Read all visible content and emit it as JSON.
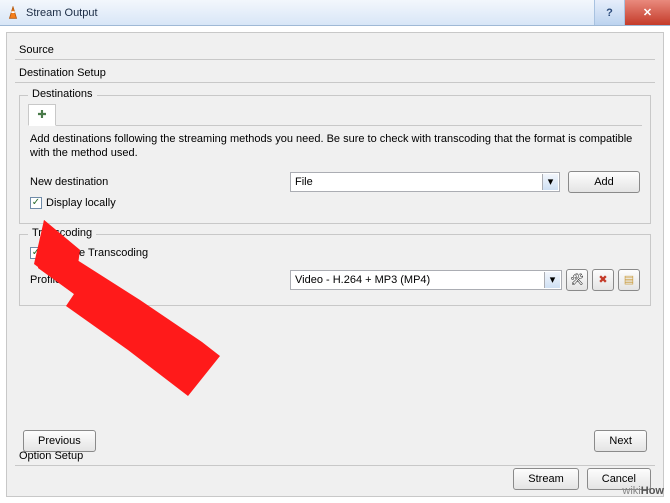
{
  "window": {
    "title": "Stream Output"
  },
  "sections": {
    "source": "Source",
    "destination_setup": "Destination Setup",
    "option_setup": "Option Setup"
  },
  "destinations": {
    "legend": "Destinations",
    "add_tab": "✚",
    "description": "Add destinations following the streaming methods you need. Be sure to check with transcoding that the format is compatible with the method used.",
    "new_destination_label": "New destination",
    "new_destination_value": "File",
    "add_button": "Add",
    "display_locally": {
      "label": "Display locally",
      "checked": true
    }
  },
  "transcoding": {
    "legend": "Transcoding",
    "activate": {
      "label": "Activate Transcoding",
      "checked": true
    },
    "profile_label": "Profile",
    "profile_value": "Video - H.264 + MP3 (MP4)"
  },
  "buttons": {
    "previous": "Previous",
    "next": "Next",
    "stream": "Stream",
    "cancel": "Cancel"
  },
  "watermark": {
    "prefix": "wiki",
    "suffix": "How"
  }
}
